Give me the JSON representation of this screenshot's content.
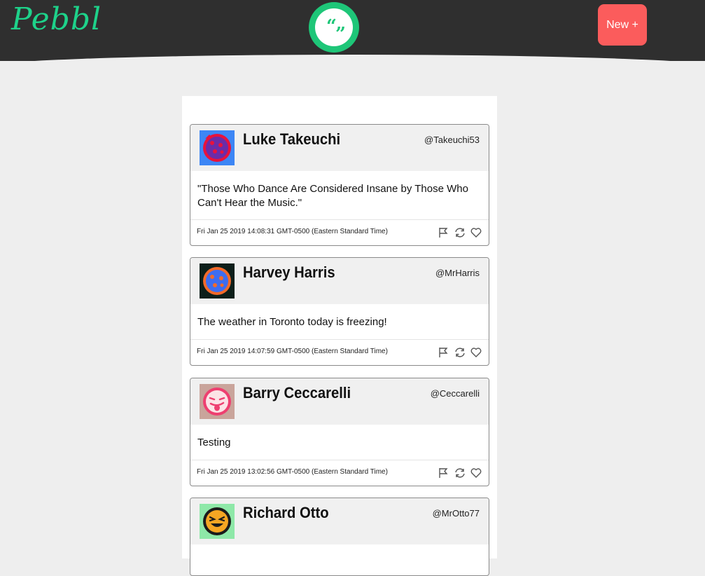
{
  "brand": "Pebbl",
  "logo_open_quote": "“",
  "logo_close_quote": "”",
  "new_button": "New +",
  "colors": {
    "header": "#2f2f2f",
    "brand": "#1ed28a",
    "logo": "#1ec678",
    "new_button": "#fb5c5c",
    "background": "#eeeeee"
  },
  "tweets": [
    {
      "name": "Luke Takeuchi",
      "handle": "@Takeuchi53",
      "text": "\"Those Who Dance Are Considered Insane by Those Who Can't Hear the Music.\"",
      "timestamp": "Fri Jan 25 2019 14:08:31 GMT-0500 (Eastern Standard Time)",
      "avatar_icon": "cookie-avatar-icon"
    },
    {
      "name": "Harvey Harris",
      "handle": "@MrHarris",
      "text": "The weather in Toronto today is freezing!",
      "timestamp": "Fri Jan 25 2019 14:07:59 GMT-0500 (Eastern Standard Time)",
      "avatar_icon": "cookie-avatar-icon"
    },
    {
      "name": "Barry Ceccarelli",
      "handle": "@Ceccarelli",
      "text": "Testing",
      "timestamp": "Fri Jan 25 2019 13:02:56 GMT-0500 (Eastern Standard Time)",
      "avatar_icon": "tongue-emoji-avatar-icon"
    },
    {
      "name": "Richard Otto",
      "handle": "@MrOtto77",
      "text": "",
      "timestamp": "",
      "avatar_icon": "laughing-emoji-avatar-icon"
    }
  ],
  "actions": [
    "flag-icon",
    "retweet-icon",
    "heart-icon"
  ]
}
